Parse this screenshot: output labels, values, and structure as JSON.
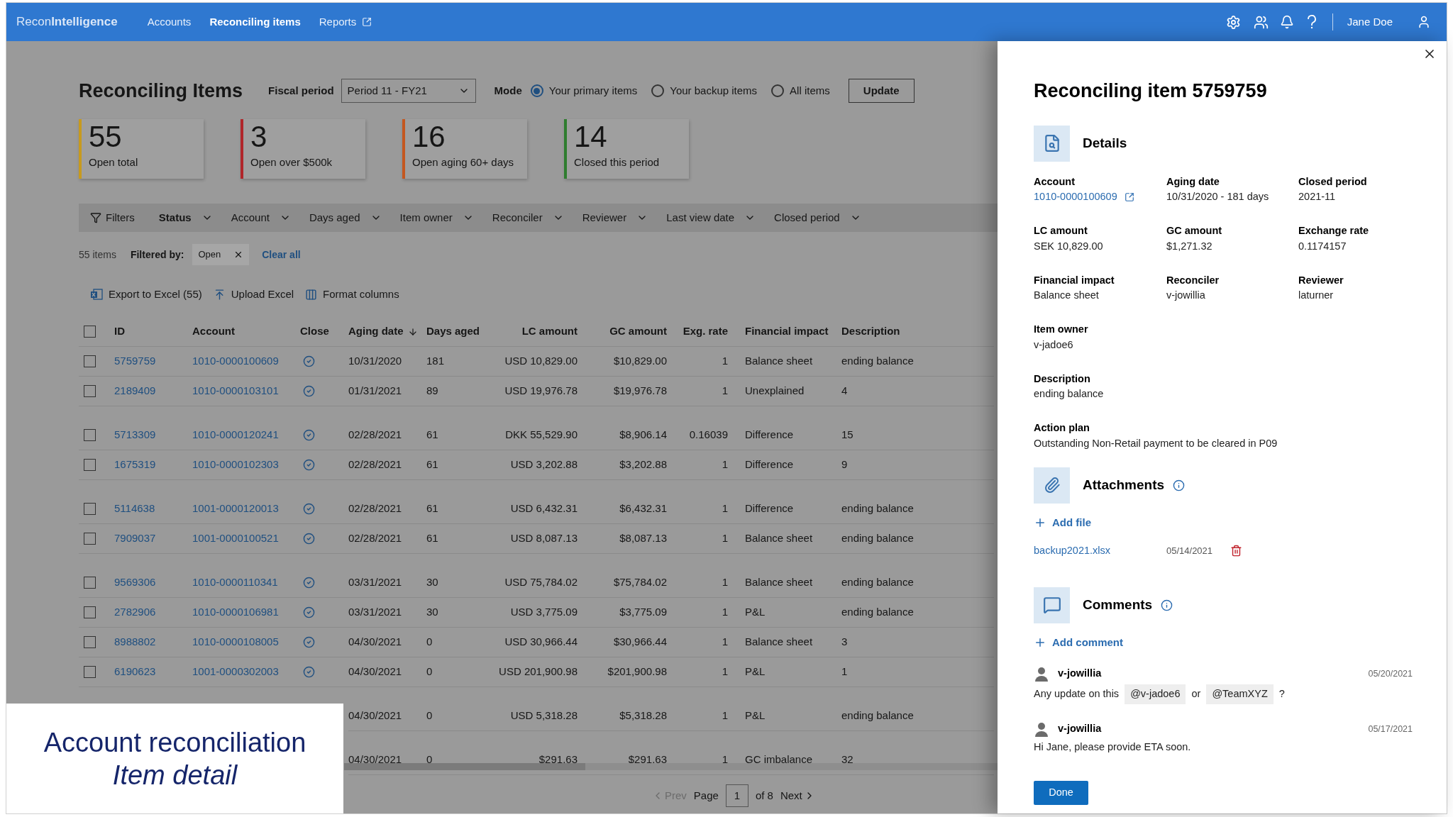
{
  "nav": {
    "brand": "Recon**Intelligence**",
    "items": [
      {
        "label": "Accounts",
        "selected": false,
        "external": false
      },
      {
        "label": "Reconciling items",
        "selected": true,
        "external": false
      },
      {
        "label": "Reports",
        "selected": false,
        "external": true
      }
    ],
    "user": "Jane Doe"
  },
  "header": {
    "title": "Reconciling Items",
    "fiscal_label": "Fiscal period",
    "fiscal_value": "Period 11 - FY21",
    "mode_label": "Mode",
    "modes": [
      {
        "label": "Your primary items",
        "selected": true
      },
      {
        "label": "Your backup items",
        "selected": false
      },
      {
        "label": "All items",
        "selected": false
      }
    ],
    "update": "Update"
  },
  "kpis": [
    {
      "value": "55",
      "label": "Open total",
      "color": "#c79a1e"
    },
    {
      "value": "3",
      "label": "Open over $500k",
      "color": "#b0262a"
    },
    {
      "value": "16",
      "label": "Open aging 60+ days",
      "color": "#c4571f"
    },
    {
      "value": "14",
      "label": "Closed this period",
      "color": "#2f7d2f"
    }
  ],
  "filters": {
    "label": "Filters",
    "items": [
      {
        "label": "Status",
        "active": true
      },
      {
        "label": "Account",
        "active": false
      },
      {
        "label": "Days aged",
        "active": false
      },
      {
        "label": "Item owner",
        "active": false
      },
      {
        "label": "Reconciler",
        "active": false
      },
      {
        "label": "Reviewer",
        "active": false
      },
      {
        "label": "Last view date",
        "active": false
      },
      {
        "label": "Closed period",
        "active": false
      }
    ]
  },
  "summary": {
    "count": "55 items",
    "filtered_by": "Filtered by:",
    "chip": "Open",
    "clear": "Clear all"
  },
  "actions": [
    {
      "kind": "excel",
      "label": "Export to Excel (55)"
    },
    {
      "kind": "upload",
      "label": "Upload Excel"
    },
    {
      "kind": "columns",
      "label": "Format columns"
    }
  ],
  "table": {
    "header_checked": false,
    "columns": [
      {
        "label": "ID",
        "sorted": false
      },
      {
        "label": "Account",
        "sorted": false
      },
      {
        "label": "Close",
        "sorted": false
      },
      {
        "label": "Aging date",
        "sorted": true
      },
      {
        "label": "Days aged",
        "sorted": false
      },
      {
        "label": "LC amount",
        "sorted": false
      },
      {
        "label": "GC amount",
        "sorted": false
      },
      {
        "label": "Exg. rate",
        "sorted": false
      },
      {
        "label": "Financial impact",
        "sorted": false
      },
      {
        "label": "Description",
        "sorted": false
      }
    ],
    "rows": [
      {
        "checked": false,
        "gap_before": false,
        "id": "5759759",
        "account": "1010-0000100609",
        "aging": "10/31/2020",
        "days": "181",
        "lc": "USD 10,829.00",
        "gc": "$10,829.00",
        "rate": "1",
        "impact": "Balance sheet",
        "description": "ending balance"
      },
      {
        "checked": false,
        "gap_before": false,
        "id": "2189409",
        "account": "1010-0000103101",
        "aging": "01/31/2021",
        "days": "89",
        "lc": "USD 19,976.78",
        "gc": "$19,976.78",
        "rate": "1",
        "impact": "Unexplained",
        "description": "4"
      },
      {
        "checked": false,
        "gap_before": true,
        "id": "5713309",
        "account": "1010-0000120241",
        "aging": "02/28/2021",
        "days": "61",
        "lc": "DKK 55,529.90",
        "gc": "$8,906.14",
        "rate": "0.16039",
        "impact": "Difference",
        "description": "15"
      },
      {
        "checked": false,
        "gap_before": false,
        "id": "1675319",
        "account": "1010-0000102303",
        "aging": "02/28/2021",
        "days": "61",
        "lc": "USD 3,202.88",
        "gc": "$3,202.88",
        "rate": "1",
        "impact": "Difference",
        "description": "9"
      },
      {
        "checked": false,
        "gap_before": true,
        "id": "5114638",
        "account": "1001-0000120013",
        "aging": "02/28/2021",
        "days": "61",
        "lc": "USD 6,432.31",
        "gc": "$6,432.31",
        "rate": "1",
        "impact": "Difference",
        "description": "ending balance"
      },
      {
        "checked": false,
        "gap_before": false,
        "id": "7909037",
        "account": "1001-0000100521",
        "aging": "02/28/2021",
        "days": "61",
        "lc": "USD 8,087.13",
        "gc": "$8,087.13",
        "rate": "1",
        "impact": "Balance sheet",
        "description": "ending balance"
      },
      {
        "checked": false,
        "gap_before": true,
        "id": "9569306",
        "account": "1010-0000110341",
        "aging": "03/31/2021",
        "days": "30",
        "lc": "USD 75,784.02",
        "gc": "$75,784.02",
        "rate": "1",
        "impact": "Balance sheet",
        "description": "ending balance"
      },
      {
        "checked": false,
        "gap_before": false,
        "id": "2782906",
        "account": "1010-0000106981",
        "aging": "03/31/2021",
        "days": "30",
        "lc": "USD 3,775.09",
        "gc": "$3,775.09",
        "rate": "1",
        "impact": "P&L",
        "description": "ending balance"
      },
      {
        "checked": false,
        "gap_before": false,
        "id": "8988802",
        "account": "1010-0000108005",
        "aging": "04/30/2021",
        "days": "0",
        "lc": "USD 30,966.44",
        "gc": "$30,966.44",
        "rate": "1",
        "impact": "Balance sheet",
        "description": "3"
      },
      {
        "checked": false,
        "gap_before": false,
        "id": "6190623",
        "account": "1001-0000302003",
        "aging": "04/30/2021",
        "days": "0",
        "lc": "USD 201,900.98",
        "gc": "$201,900.98",
        "rate": "1",
        "impact": "P&L",
        "description": "1"
      },
      {
        "gap_before": true,
        "aging": "04/30/2021",
        "days": "0",
        "lc": "USD 5,318.28",
        "gc": "$5,318.28",
        "rate": "1",
        "impact": "P&L",
        "description": "ending balance"
      },
      {
        "gap_before": true,
        "aging": "04/30/2021",
        "days": "0",
        "lc": "$291.63",
        "gc": "$291.63",
        "rate": "1",
        "impact": "GC imbalance",
        "description": "32"
      }
    ]
  },
  "pagination": {
    "prev": "Prev",
    "page_label": "Page",
    "page": "1",
    "of": "of 8",
    "next": "Next"
  },
  "caption": {
    "title": "Account reconciliation",
    "subtitle": "Item detail"
  },
  "panel": {
    "title": "Reconciling item 5759759",
    "details_title": "Details",
    "fields": [
      {
        "label": "Account",
        "value": "1010-0000100609",
        "kind": "link"
      },
      {
        "label": "Aging date",
        "value": "10/31/2020 - 181 days",
        "kind": "text"
      },
      {
        "label": "Closed period",
        "value": "2021-11",
        "kind": "text"
      },
      {
        "label": "LC amount",
        "value": "SEK 10,829.00",
        "kind": "text"
      },
      {
        "label": "GC amount",
        "value": "$1,271.32",
        "kind": "text"
      },
      {
        "label": "Exchange rate",
        "value": "0.1174157",
        "kind": "text"
      },
      {
        "label": "Financial impact",
        "value": "Balance sheet",
        "kind": "text"
      },
      {
        "label": "Reconciler",
        "value": "v-jowillia",
        "kind": "text"
      },
      {
        "label": "Reviewer",
        "value": "laturner",
        "kind": "text"
      },
      {
        "label": "Item owner",
        "value": "v-jadoe6",
        "kind": "wide"
      },
      {
        "label": "Description",
        "value": "ending balance",
        "kind": "wide"
      },
      {
        "label": "Action plan",
        "value": "Outstanding Non-Retail payment to be cleared in P09",
        "kind": "wide"
      }
    ],
    "attachments_title": "Attachments",
    "add_file": "Add file",
    "files": [
      {
        "name": "backup2021.xlsx",
        "date": "05/14/2021"
      }
    ],
    "comments_title": "Comments",
    "add_comment": "Add comment",
    "comments": [
      {
        "author": "v-jowillia",
        "date": "05/20/2021",
        "parts": [
          {
            "kind": "text",
            "text": "Any update on this"
          },
          {
            "kind": "mention",
            "text": "@v-jadoe6"
          },
          {
            "kind": "text",
            "text": "or"
          },
          {
            "kind": "mention",
            "text": "@TeamXYZ"
          },
          {
            "kind": "text",
            "text": "?"
          }
        ]
      },
      {
        "author": "v-jowillia",
        "date": "05/17/2021",
        "parts": [
          {
            "kind": "text",
            "text": "Hi Jane, please provide ETA soon."
          }
        ]
      }
    ],
    "done": "Done"
  }
}
